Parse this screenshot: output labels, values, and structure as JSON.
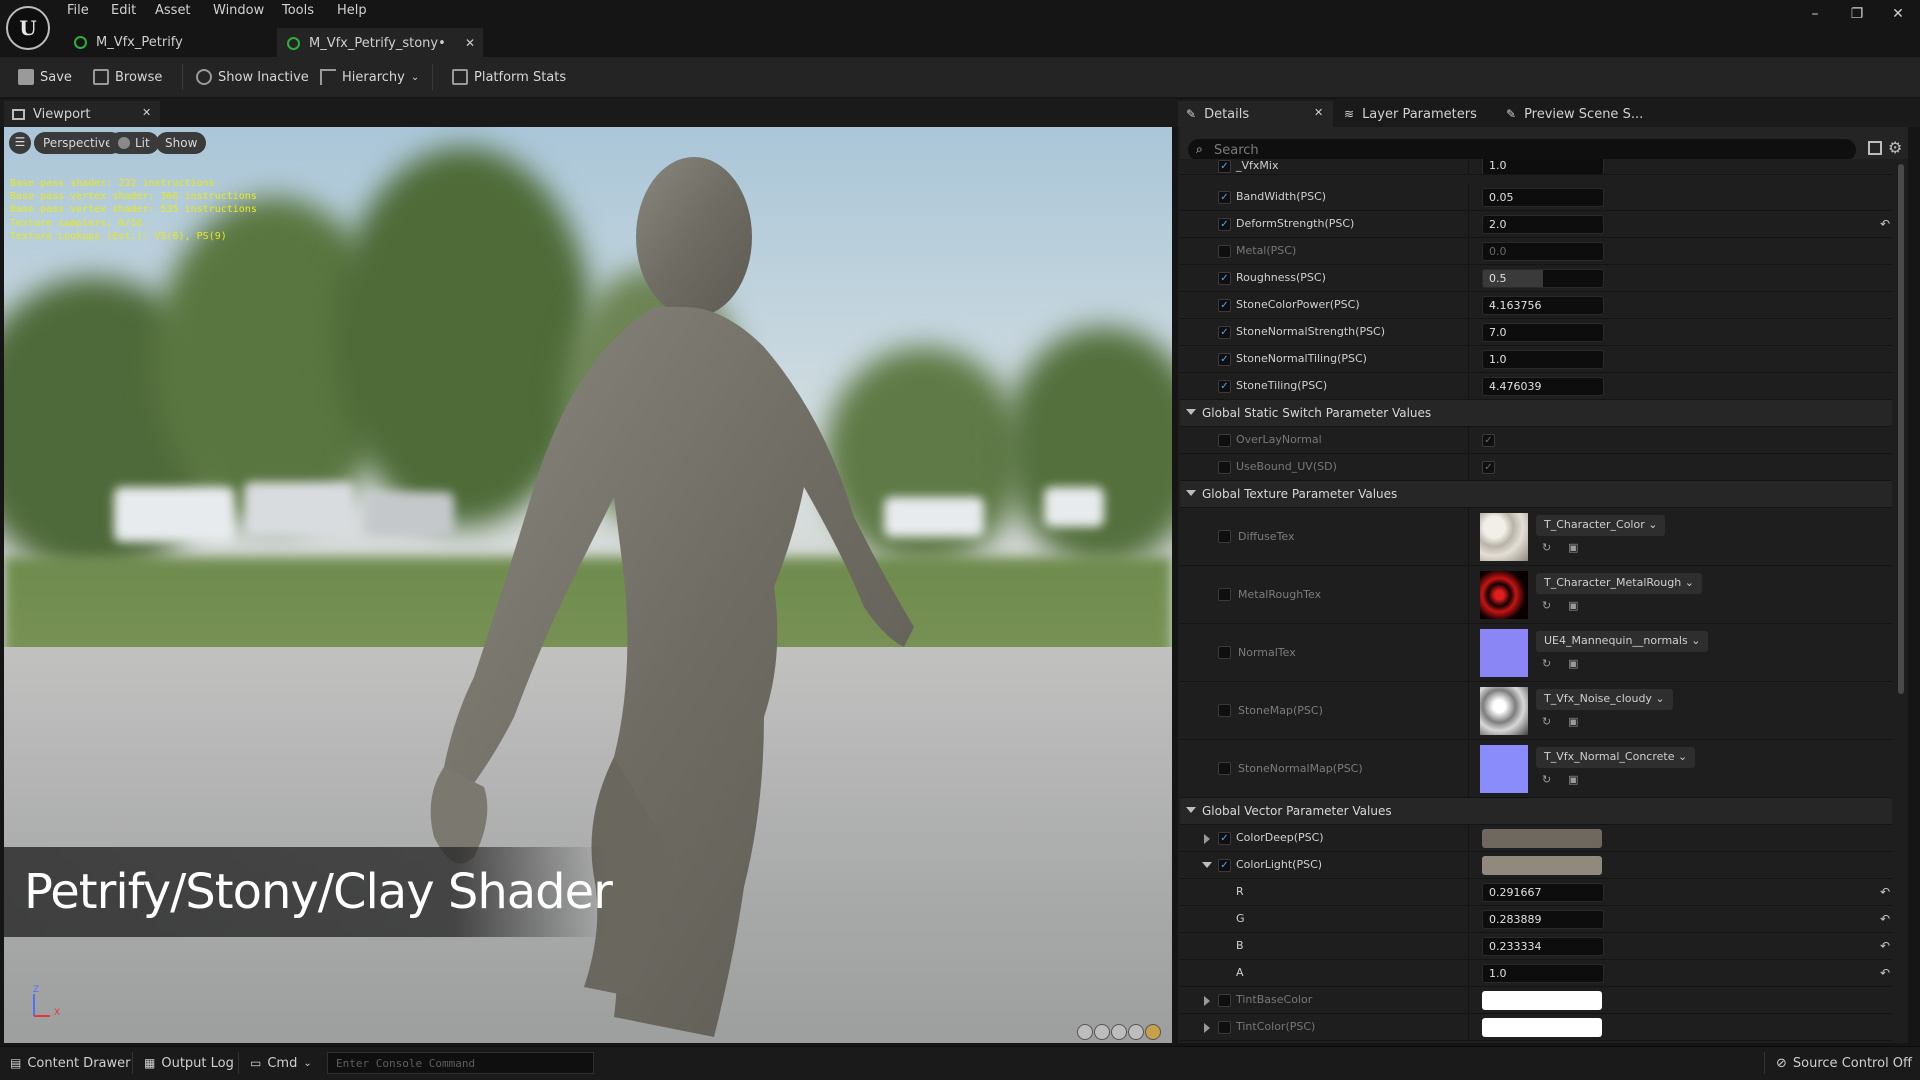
{
  "menu": [
    "File",
    "Edit",
    "Asset",
    "Window",
    "Tools",
    "Help"
  ],
  "doc_tabs": [
    {
      "label": "M_Vfx_Petrify",
      "active": false
    },
    {
      "label": "M_Vfx_Petrify_stony•",
      "active": true
    }
  ],
  "window_controls": {
    "minimize": "–",
    "restore": "❐",
    "close": "✕"
  },
  "toolbar": {
    "save": "Save",
    "browse": "Browse",
    "show_inactive": "Show Inactive",
    "hierarchy": "Hierarchy",
    "platform_stats": "Platform Stats"
  },
  "viewport": {
    "tab_label": "Viewport",
    "perspective": "Perspective",
    "lit": "Lit",
    "show": "Show",
    "stats": [
      "Base pass shader: 232 instructions",
      "Base pass vertex shader: 366 instructions",
      "Base pass vertex shader: 535 instructions",
      "Texture samplers: 8/16",
      "Texture Lookups (Est.): VS(6), PS(9)"
    ],
    "banner": "Petrify/Stony/Clay Shader",
    "axis_z": "Z",
    "axis_x": "X"
  },
  "right_tabs": {
    "details": "Details",
    "layer_params": "Layer Parameters",
    "preview_scene": "Preview Scene S..."
  },
  "search_placeholder": "Search",
  "scalar_rows": [
    {
      "label": "_VfxMix",
      "value": "1.0",
      "checked": true,
      "disabled": false,
      "reset": false
    },
    {
      "label": "BandWidth(PSC)",
      "value": "0.05",
      "checked": true,
      "disabled": false,
      "reset": false
    },
    {
      "label": "DeformStrength(PSC)",
      "value": "2.0",
      "checked": true,
      "disabled": false,
      "reset": true
    },
    {
      "label": "Metal(PSC)",
      "value": "0.0",
      "checked": false,
      "disabled": true,
      "reset": false
    },
    {
      "label": "Roughness(PSC)",
      "value": "0.5",
      "checked": true,
      "disabled": false,
      "reset": false
    },
    {
      "label": "StoneColorPower(PSC)",
      "value": "4.163756",
      "checked": true,
      "disabled": false,
      "reset": false
    },
    {
      "label": "StoneNormalStrength(PSC)",
      "value": "7.0",
      "checked": true,
      "disabled": false,
      "reset": false
    },
    {
      "label": "StoneNormalTiling(PSC)",
      "value": "1.0",
      "checked": true,
      "disabled": false,
      "reset": false
    },
    {
      "label": "StoneTiling(PSC)",
      "value": "4.476039",
      "checked": true,
      "disabled": false,
      "reset": false
    }
  ],
  "sections": {
    "static_switch": "Global Static Switch Parameter Values",
    "texture": "Global Texture Parameter Values",
    "vector": "Global Vector Parameter Values"
  },
  "switch_rows": [
    {
      "label": "OverLayNormal"
    },
    {
      "label": "UseBound_UV(SD)"
    }
  ],
  "texture_rows": [
    {
      "label": "DiffuseTex",
      "asset": "T_Character_Color"
    },
    {
      "label": "MetalRoughTex",
      "asset": "T_Character_MetalRough"
    },
    {
      "label": "NormalTex",
      "asset": "UE4_Mannequin__normals"
    },
    {
      "label": "StoneMap(PSC)",
      "asset": "T_Vfx_Noise_cloudy"
    },
    {
      "label": "StoneNormalMap(PSC)",
      "asset": "T_Vfx_Normal_Concrete"
    }
  ],
  "vector_rows": {
    "color_deep": {
      "label": "ColorDeep(PSC)",
      "color": "#6e685e"
    },
    "color_light": {
      "label": "ColorLight(PSC)",
      "color": "#8f8a7c"
    },
    "channels": [
      {
        "label": "R",
        "value": "0.291667"
      },
      {
        "label": "G",
        "value": "0.283889"
      },
      {
        "label": "B",
        "value": "0.233334"
      },
      {
        "label": "A",
        "value": "1.0"
      }
    ],
    "tint_base": {
      "label": "TintBaseColor",
      "color": "#ffffff"
    },
    "tint_color": {
      "label": "TintColor(PSC)",
      "color": "#ffffff"
    }
  },
  "statusbar": {
    "content_drawer": "Content Drawer",
    "output_log": "Output Log",
    "cmd": "Cmd",
    "console_placeholder": "Enter Console Command",
    "source_control": "Source Control Off"
  }
}
